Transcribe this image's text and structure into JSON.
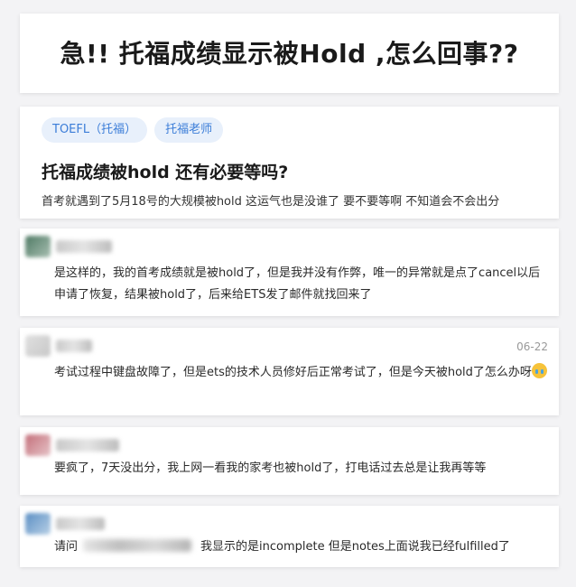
{
  "page_title": "急!! 托福成绩显示被Hold ,怎么回事??",
  "question": {
    "tags": [
      "TOEFL（托福）",
      "托福老师"
    ],
    "title": "托福成绩被hold 还有必要等吗?",
    "excerpt": "首考就遇到了5月18号的大规模被hold 这运气也是没谁了 要不要等啊 不知道会不会出分"
  },
  "comments": [
    {
      "text": "是这样的，我的首考成绩就是被hold了，但是我并没有作弊，唯一的异常就是点了cancel以后申请了恢复，结果被hold了，后来给ETS发了邮件就找回来了",
      "date": ""
    },
    {
      "text": "考试过程中键盘故障了，但是ets的技术人员修好后正常考试了，但是今天被hold了怎么办呀",
      "date": "06-22",
      "emoji": "crying-face-icon"
    },
    {
      "text": "要疯了，7天没出分，我上网一看我的家考也被hold了，打电话过去总是让我再等等",
      "date": ""
    },
    {
      "text_before": "请问",
      "text_after": "我显示的是incomplete 但是notes上面说我已经fulfilled了",
      "date": ""
    }
  ],
  "colors": {
    "tag_bg": "#e8f0fb",
    "tag_text": "#3b7dd8",
    "date_text": "#999999"
  }
}
